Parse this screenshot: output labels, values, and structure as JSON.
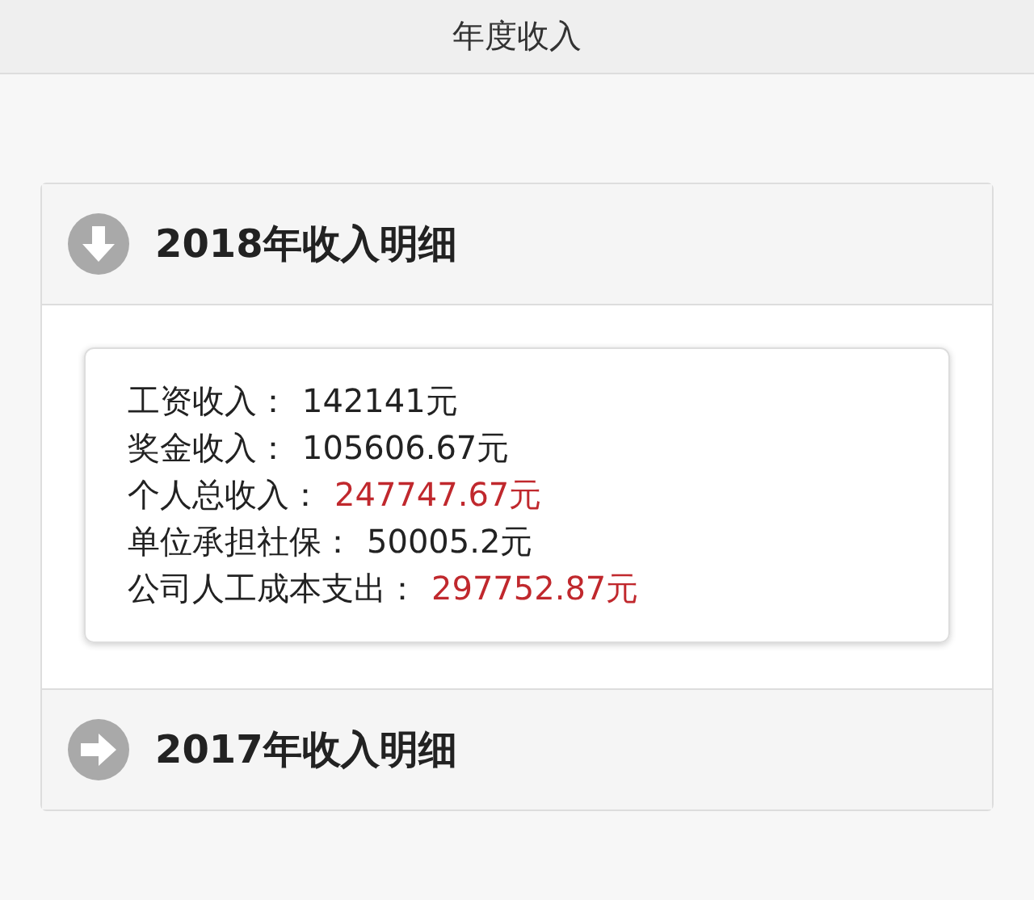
{
  "header": {
    "title": "年度收入"
  },
  "sections": [
    {
      "title": "2018年收入明细",
      "expanded": true,
      "items": [
        {
          "label": "工资收入：",
          "value": "142141元",
          "highlight": false
        },
        {
          "label": "奖金收入：",
          "value": "105606.67元",
          "highlight": false
        },
        {
          "label": "个人总收入：",
          "value": "247747.67元",
          "highlight": true
        },
        {
          "label": "单位承担社保：",
          "value": "50005.2元",
          "highlight": false
        },
        {
          "label": "公司人工成本支出：",
          "value": "297752.87元",
          "highlight": true
        }
      ]
    },
    {
      "title": "2017年收入明细",
      "expanded": false
    }
  ]
}
